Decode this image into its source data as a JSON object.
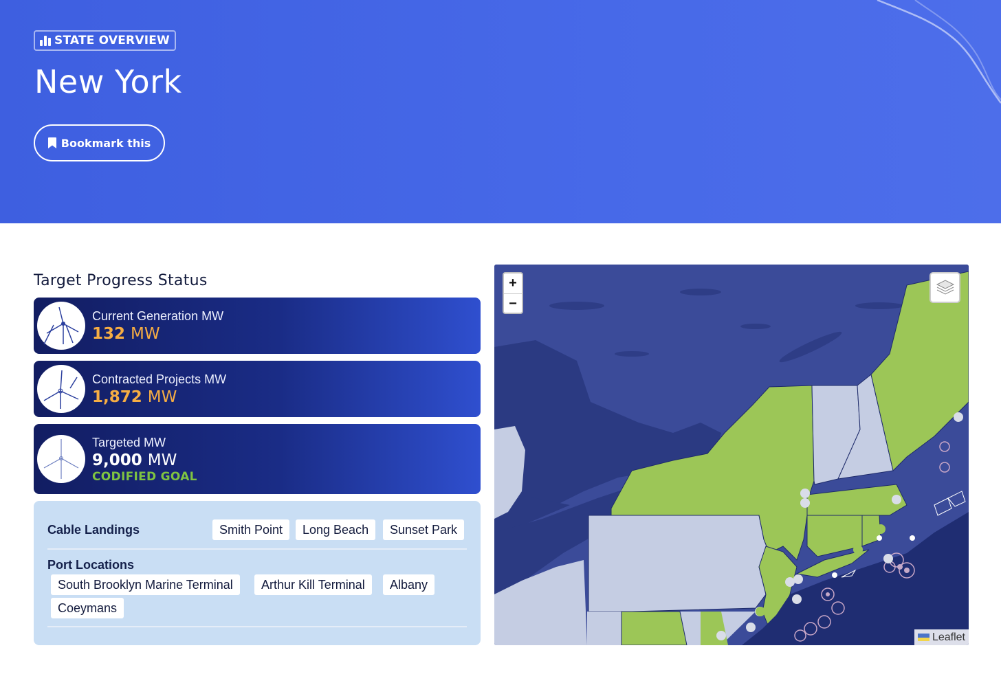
{
  "header": {
    "badge_label": "STATE OVERVIEW",
    "title": "New York",
    "bookmark_label": "Bookmark this"
  },
  "progress": {
    "section_title": "Target Progress Status",
    "cards": [
      {
        "label": "Current Generation MW",
        "value": "132",
        "unit": "MW",
        "value_color": "#f6ad43"
      },
      {
        "label": "Contracted Projects MW",
        "value": "1,872",
        "unit": "MW",
        "value_color": "#f6ad43"
      },
      {
        "label": "Targeted MW",
        "value": "9,000",
        "unit": "MW",
        "value_color": "#ffffff",
        "sub": "CODIFIED GOAL",
        "sub_color": "#7fc441"
      }
    ]
  },
  "info": {
    "cable_landings_label": "Cable Landings",
    "cable_landings": [
      "Smith Point",
      "Long Beach",
      "Sunset Park"
    ],
    "port_locations_label": "Port Locations",
    "port_locations": [
      "South Brooklyn Marine Terminal",
      "Arthur Kill Terminal",
      "Albany",
      "Coeymans"
    ]
  },
  "map": {
    "zoom_in": "+",
    "zoom_out": "−",
    "attribution": "Leaflet",
    "colors": {
      "water": "#2b3a82",
      "land": "#3b4b99",
      "highlight": "#9cc657",
      "other_state": "#c5cde3"
    }
  }
}
